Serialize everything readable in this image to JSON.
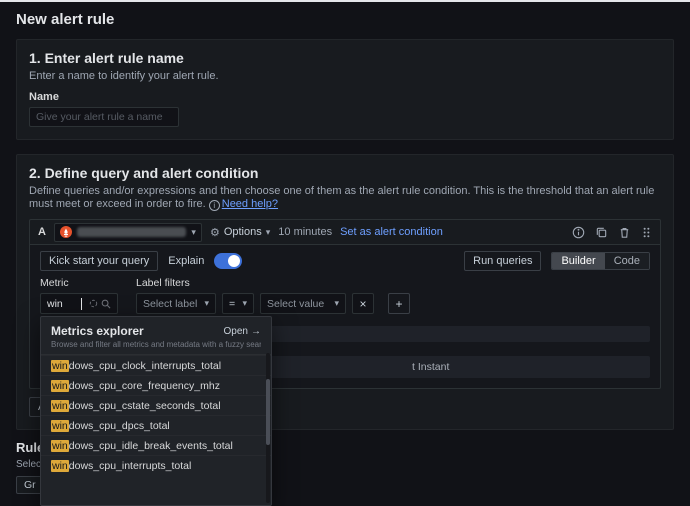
{
  "page": {
    "title": "New alert rule"
  },
  "step1": {
    "title": "1. Enter alert rule name",
    "description": "Enter a name to identify your alert rule.",
    "name_label": "Name",
    "name_placeholder": "Give your alert rule a name"
  },
  "step2": {
    "title": "2. Define query and alert condition",
    "description": "Define queries and/or expressions and then choose one of them as the alert rule condition. This is the threshold that an alert rule must meet or exceed in order to fire.",
    "help_link": "Need help?"
  },
  "query": {
    "ref_id": "A",
    "options_label": "Options",
    "time_range": "10 minutes",
    "set_alert_condition": "Set as alert condition",
    "kick_start_label": "Kick start your query",
    "explain_label": "Explain",
    "explain_enabled": true,
    "run_queries_label": "Run queries",
    "mode_builder": "Builder",
    "mode_code": "Code",
    "metric_label": "Metric",
    "metric_value": "win",
    "label_filters_label": "Label filters",
    "select_label_placeholder": "Select label",
    "operator_value": "=",
    "select_value_placeholder": "Select value",
    "options_partial_text": "t Instant",
    "add_query_partial": "Ad"
  },
  "metrics_explorer": {
    "title": "Metrics explorer",
    "open_label": "Open",
    "subtitle": "Browse and filter all metrics and metadata with a fuzzy search",
    "highlight": "win",
    "items": [
      "windows_cpu_clock_interrupts_total",
      "windows_cpu_core_frequency_mhz",
      "windows_cpu_cstate_seconds_total",
      "windows_cpu_dpcs_total",
      "windows_cpu_idle_break_events_total",
      "windows_cpu_interrupts_total"
    ]
  },
  "bottom": {
    "rule_partial": "Rule",
    "select_partial": "Selec",
    "group_partial": "Gr"
  },
  "icons": {
    "chevron_down": "▾",
    "gear": "⚙",
    "info": "i",
    "close": "×",
    "plus": "+",
    "arrow_right": "→"
  },
  "colors": {
    "accent_blue": "#3d71d9",
    "link_blue": "#6e9fff",
    "highlight_yellow": "#dda83a",
    "prometheus_orange": "#e6522c"
  }
}
